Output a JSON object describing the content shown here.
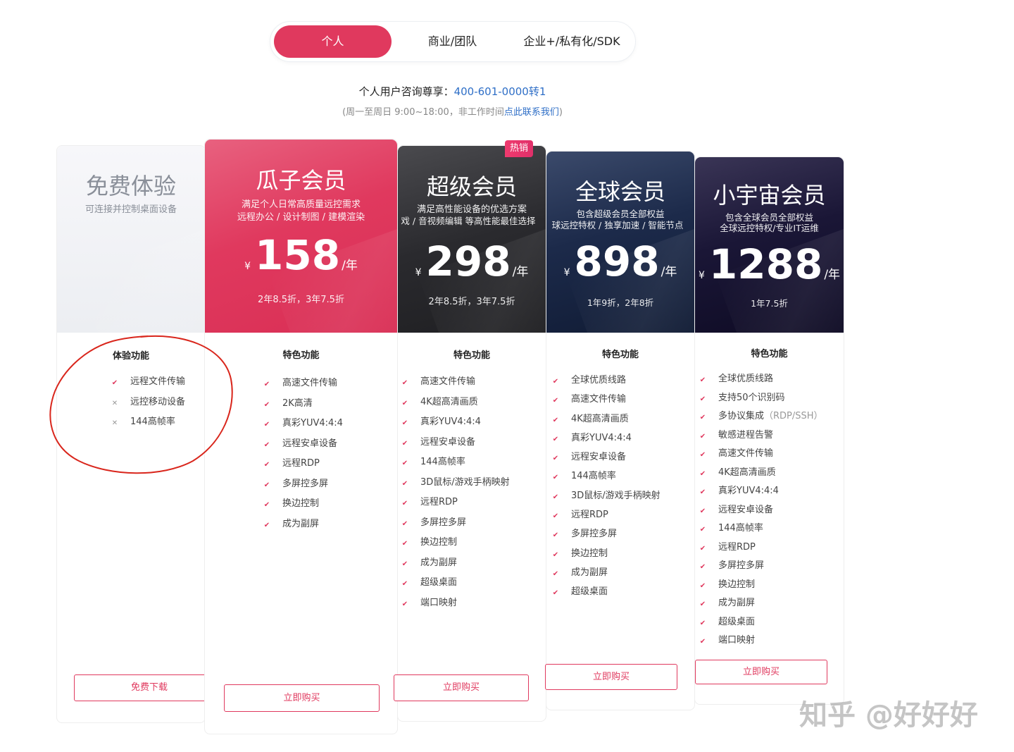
{
  "tabs": [
    {
      "label": "个人",
      "active": true
    },
    {
      "label": "商业/团队",
      "active": false
    },
    {
      "label": "企业+/私有化/SDK",
      "active": false
    }
  ],
  "consult": {
    "prefix": "个人用户咨询尊享：",
    "phone": "400-601-0000转1"
  },
  "hours": {
    "text": "(周一至周日 9:00~18:00，非工作时间",
    "link": "点此联系我们",
    "suffix": ")"
  },
  "plans": {
    "free": {
      "title": "免费体验",
      "desc": "可连接并控制桌面设备",
      "feature_title": "体验功能",
      "features": [
        {
          "text": "远程文件传输",
          "mark": "check"
        },
        {
          "text": "远控移动设备",
          "mark": "cross"
        },
        {
          "text": "144高帧率",
          "mark": "cross"
        }
      ],
      "button": "免费下载"
    },
    "guazi": {
      "title": "瓜子会员",
      "desc1": "满足个人日常高质量远控需求",
      "desc2": "远程办公 / 设计制图 / 建模渲染",
      "currency": "¥",
      "price": "158",
      "unit": "/年",
      "discount": "2年8.5折，3年7.5折",
      "feature_title": "特色功能",
      "features": [
        "高速文件传输",
        "2K高清",
        "真彩YUV4:4:4",
        "远程安卓设备",
        "远程RDP",
        "多屏控多屏",
        "换边控制",
        "成为副屏"
      ],
      "button": "立即购买"
    },
    "super": {
      "badge": "热销",
      "title": "超级会员",
      "desc1": "满足高性能设备的优选方案",
      "desc2": "戏 / 音视频编辑 等高性能最佳选择",
      "currency": "¥",
      "price": "298",
      "unit": "/年",
      "discount": "2年8.5折，3年7.5折",
      "feature_title": "特色功能",
      "features": [
        "高速文件传输",
        "4K超高清画质",
        "真彩YUV4:4:4",
        "远程安卓设备",
        "144高帧率",
        "3D鼠标/游戏手柄映射",
        "远程RDP",
        "多屏控多屏",
        "换边控制",
        "成为副屏",
        "超级桌面",
        "端口映射"
      ],
      "button": "立即购买"
    },
    "global": {
      "title": "全球会员",
      "desc1": "包含超级会员全部权益",
      "desc2": "球远控特权 / 独享加速 / 智能节点",
      "currency": "¥",
      "price": "898",
      "unit": "/年",
      "discount": "1年9折，2年8折",
      "feature_title": "特色功能",
      "features": [
        "全球优质线路",
        "高速文件传输",
        "4K超高清画质",
        "真彩YUV4:4:4",
        "远程安卓设备",
        "144高帧率",
        "3D鼠标/游戏手柄映射",
        "远程RDP",
        "多屏控多屏",
        "换边控制",
        "成为副屏",
        "超级桌面"
      ],
      "button": "立即购买"
    },
    "universe": {
      "title": "小宇宙会员",
      "desc1": "包含全球会员全部权益",
      "desc2": "全球远控特权/专业IT运维",
      "currency": "¥",
      "price": "1288",
      "unit": "/年",
      "discount": "1年7.5折",
      "feature_title": "特色功能",
      "features": [
        "全球优质线路",
        "支持50个识别码",
        "多协议集成",
        "敏感进程告警",
        "高速文件传输",
        "4K超高清画质",
        "真彩YUV4:4:4",
        "远程安卓设备",
        "144高帧率",
        "远程RDP",
        "多屏控多屏",
        "换边控制",
        "成为副屏",
        "超级桌面",
        "端口映射"
      ],
      "feature_note": "（RDP/SSH）",
      "button": "立即购买"
    }
  },
  "watermark": "知乎 @好好好",
  "colors": {
    "accent": "#e0395e",
    "link": "#2f6fc7",
    "annotation": "#d9261c"
  }
}
